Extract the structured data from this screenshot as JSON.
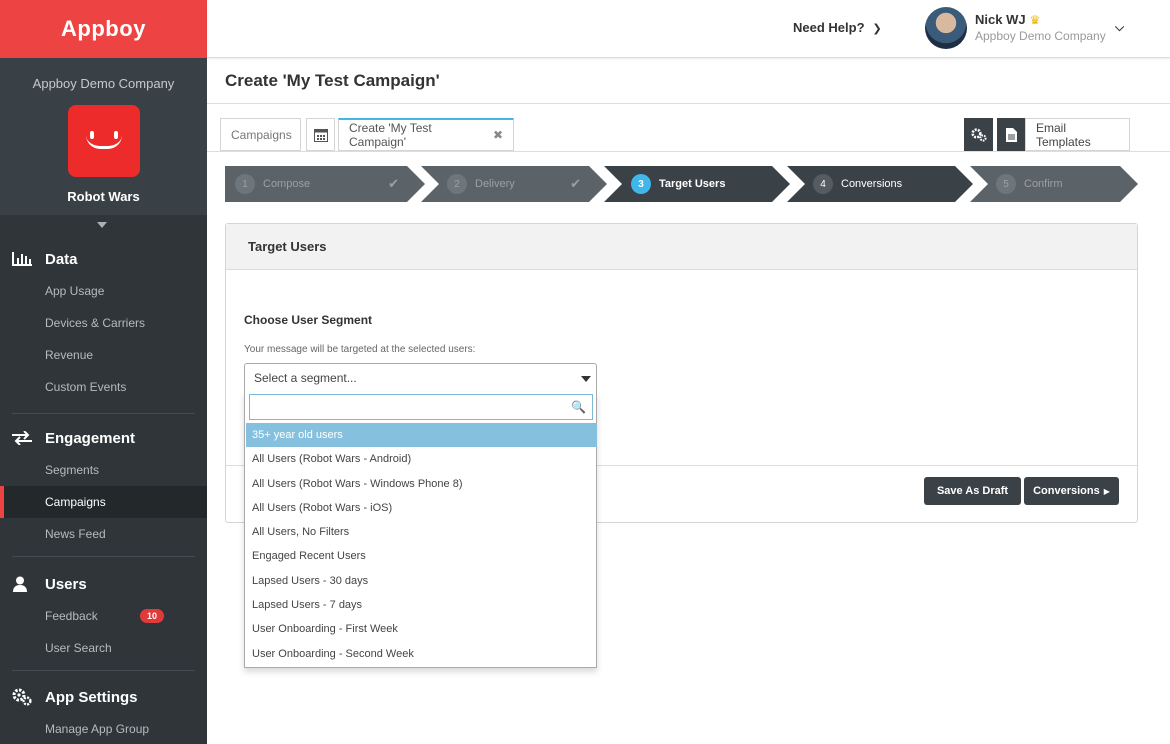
{
  "brand": {
    "name": "Appboy",
    "accent": "#ee4343",
    "highlight": "#40b7e8"
  },
  "sidebar": {
    "company": "Appboy Demo Company",
    "app_name": "Robot Wars",
    "sections": [
      {
        "title": "Data",
        "icon": "bar-chart-icon",
        "items": [
          "App Usage",
          "Devices & Carriers",
          "Revenue",
          "Custom Events"
        ]
      },
      {
        "title": "Engagement",
        "icon": "arrows-exchange-icon",
        "items": [
          "Segments",
          "Campaigns",
          "News Feed"
        ],
        "active": "Campaigns"
      },
      {
        "title": "Users",
        "icon": "user-icon",
        "items": [
          "Feedback",
          "User Search"
        ],
        "badge": "10"
      },
      {
        "title": "App Settings",
        "icon": "gears-icon",
        "items": [
          "Manage App Group"
        ]
      }
    ]
  },
  "topbar": {
    "help": "Need Help?",
    "user_name": "Nick WJ",
    "user_company": "Appboy Demo Company"
  },
  "page": {
    "title": "Create 'My Test Campaign'"
  },
  "tabs": {
    "campaigns": "Campaigns",
    "create": "Create 'My Test Campaign'",
    "email_templates": "Email Templates"
  },
  "steps": [
    {
      "num": "1",
      "label": "Compose",
      "state": "done"
    },
    {
      "num": "2",
      "label": "Delivery",
      "state": "done"
    },
    {
      "num": "3",
      "label": "Target Users",
      "state": "current"
    },
    {
      "num": "4",
      "label": "Conversions",
      "state": "next"
    },
    {
      "num": "5",
      "label": "Confirm",
      "state": "todo"
    }
  ],
  "panel": {
    "title": "Target Users",
    "segment_heading": "Choose User Segment",
    "segment_help": "Your message will be targeted at the selected users:",
    "select_placeholder": "Select a segment...",
    "save_draft": "Save As Draft",
    "conversions": "Conversions"
  },
  "segments": [
    "35+ year old users",
    "All Users (Robot Wars - Android)",
    "All Users (Robot Wars - Windows Phone 8)",
    "All Users (Robot Wars - iOS)",
    "All Users, No Filters",
    "Engaged Recent Users",
    "Lapsed Users - 30 days",
    "Lapsed Users - 7 days",
    "User Onboarding - First Week",
    "User Onboarding - Second Week"
  ],
  "highlighted_segment": "35+ year old users"
}
